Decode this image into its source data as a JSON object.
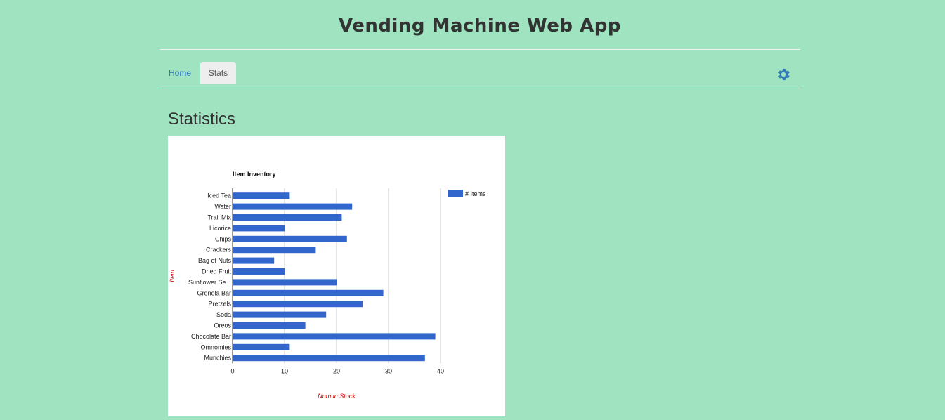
{
  "app": {
    "title": "Vending Machine Web App"
  },
  "nav": {
    "tabs": [
      {
        "label": "Home",
        "active": false
      },
      {
        "label": "Stats",
        "active": true
      }
    ],
    "settings_icon": "gear-icon"
  },
  "page": {
    "heading": "Statistics"
  },
  "colors": {
    "background": "#9fe3c0",
    "bar": "#3366cc",
    "axis_title": "#cc0000",
    "link": "#337ab7"
  },
  "chart_data": {
    "type": "bar",
    "orientation": "horizontal",
    "title": "Item Inventory",
    "xlabel": "Num in Stock",
    "ylabel": "Item",
    "xlim": [
      0,
      40
    ],
    "xticks": [
      0,
      10,
      20,
      30,
      40
    ],
    "grid": true,
    "legend_position": "right",
    "categories": [
      "Iced Tea",
      "Water",
      "Trail Mix",
      "Licorice",
      "Chips",
      "Crackers",
      "Bag of Nuts",
      "Dried Fruit",
      "Sunflower Se...",
      "Gronola Bar",
      "Pretzels",
      "Soda",
      "Oreos",
      "Chocolate Bar",
      "Omnomies",
      "Munchies"
    ],
    "series": [
      {
        "name": "# Items",
        "values": [
          11,
          23,
          21,
          10,
          22,
          16,
          8,
          10,
          20,
          29,
          25,
          18,
          14,
          39,
          11,
          37
        ]
      }
    ]
  }
}
